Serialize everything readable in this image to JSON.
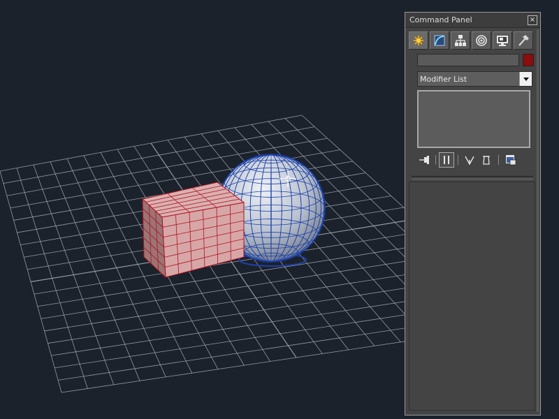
{
  "command_panel": {
    "title": "Command Panel",
    "close_glyph": "×",
    "tabs": [
      {
        "name": "create",
        "icon": "create-star-icon",
        "active": true
      },
      {
        "name": "modify",
        "icon": "modify-arc-icon",
        "active": false
      },
      {
        "name": "hierarchy",
        "icon": "hierarchy-tree-icon",
        "active": false
      },
      {
        "name": "motion",
        "icon": "motion-rings-icon",
        "active": false
      },
      {
        "name": "display",
        "icon": "display-monitor-icon",
        "active": false
      },
      {
        "name": "utilities",
        "icon": "utilities-hammer-icon",
        "active": false
      }
    ],
    "object_name": "",
    "object_color": "#8b0d0d",
    "modifier_list": {
      "selected": "Modifier List"
    },
    "stack_tools": [
      "pin-stack-icon",
      "show-end-result-icon",
      "make-unique-icon",
      "remove-modifier-icon",
      "configure-modifier-sets-icon"
    ]
  },
  "viewport": {
    "background": "#1c222b",
    "grid_color": "#a8aeb7",
    "box_color": "#d7a7a7",
    "box_wire_color": "#b01020",
    "sphere_color": "#c9d0dc",
    "sphere_wire_color": "#1b3fa8"
  }
}
